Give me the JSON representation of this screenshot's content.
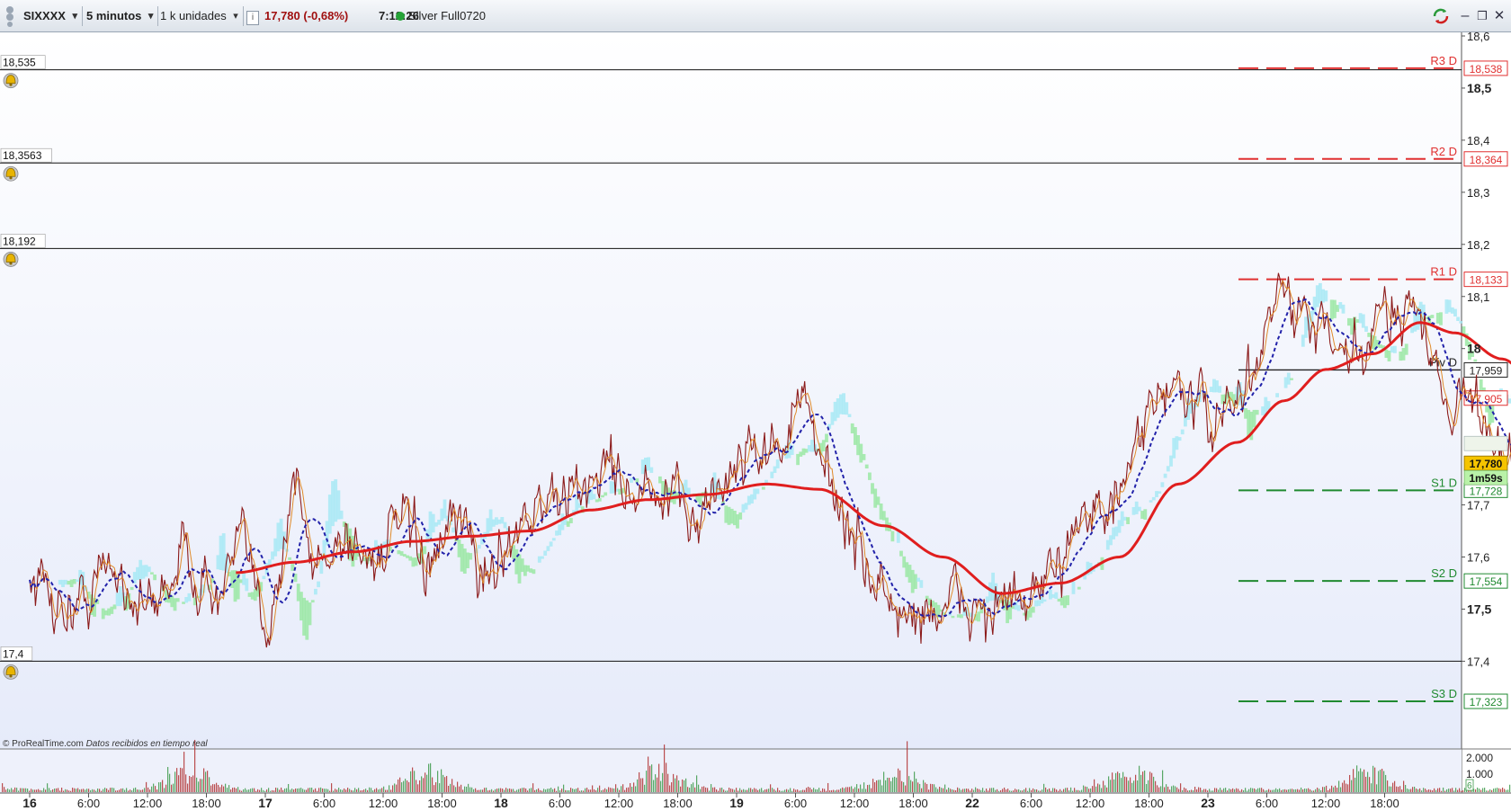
{
  "toolbar": {
    "symbol": "SIXXXX",
    "timeframe": "5 minutos",
    "units": "1 k unidades",
    "info_icon": "i",
    "last_change": "17,780 (-0,68%)",
    "time": "7:12:26",
    "instrument": "Silver Full0720",
    "icons": [
      "settings-icon",
      "refresh-icon",
      "minimize-icon",
      "restore-icon",
      "close-icon"
    ],
    "minimize_glyph": "–",
    "restore_glyph": "❐",
    "close_glyph": "✕"
  },
  "footer": {
    "copyright": "© ProRealTime.com",
    "realtime": "Datos recibidos en tiempo real"
  },
  "colors": {
    "background_top": "#ffffff",
    "background_bottom": "#e6ebfa",
    "price_line": "#8b1a1a",
    "short_ma": "#e08a2a",
    "dashed_ma": "#2222aa",
    "long_ma": "#e01e1e",
    "cloud_bull": "#9be8a5",
    "cloud_bear": "#a8e9f5",
    "resistance": "#e03030",
    "support": "#208a30",
    "pivot": "#222222",
    "last_price_bg": "#f5c400"
  },
  "chart_data": {
    "type": "line",
    "title": "SIXXXX · Silver Full0720 · 5 minutos",
    "ylim": [
      17.355,
      18.63
    ],
    "y_ticks": [
      "18,6",
      "18,5",
      "18,4",
      "18,3",
      "18,2",
      "18,1",
      "18",
      "17,7",
      "17,6",
      "17,5",
      "17,4"
    ],
    "y_ticks_bold": [
      "18,5",
      "18",
      "17,5"
    ],
    "x_ticks": [
      {
        "label": "16",
        "bold": true
      },
      {
        "label": "6:00",
        "bold": false
      },
      {
        "label": "12:00",
        "bold": false
      },
      {
        "label": "18:00",
        "bold": false
      },
      {
        "label": "17",
        "bold": true
      },
      {
        "label": "6:00",
        "bold": false
      },
      {
        "label": "12:00",
        "bold": false
      },
      {
        "label": "18:00",
        "bold": false
      },
      {
        "label": "18",
        "bold": true
      },
      {
        "label": "6:00",
        "bold": false
      },
      {
        "label": "12:00",
        "bold": false
      },
      {
        "label": "18:00",
        "bold": false
      },
      {
        "label": "19",
        "bold": true
      },
      {
        "label": "6:00",
        "bold": false
      },
      {
        "label": "12:00",
        "bold": false
      },
      {
        "label": "18:00",
        "bold": false
      },
      {
        "label": "22",
        "bold": true
      },
      {
        "label": "6:00",
        "bold": false
      },
      {
        "label": "12:00",
        "bold": false
      },
      {
        "label": "18:00",
        "bold": false
      },
      {
        "label": "23",
        "bold": true
      },
      {
        "label": "6:00",
        "bold": false
      },
      {
        "label": "12:00",
        "bold": false
      },
      {
        "label": "18:00",
        "bold": false
      }
    ],
    "alert_lines": [
      {
        "value": 18.535,
        "label": "18,535"
      },
      {
        "value": 18.3563,
        "label": "18,3563"
      },
      {
        "value": 18.192,
        "label": "18,192"
      },
      {
        "value": 17.4,
        "label": "17,4"
      }
    ],
    "pivot_levels": [
      {
        "name": "R3 D",
        "value": 18.538,
        "label": "18,538",
        "kind": "resistance"
      },
      {
        "name": "R2 D",
        "value": 18.364,
        "label": "18,364",
        "kind": "resistance"
      },
      {
        "name": "R1 D",
        "value": 18.133,
        "label": "18,133",
        "kind": "resistance"
      },
      {
        "name": "Piv D",
        "value": 17.959,
        "label": "17,959",
        "kind": "pivot"
      },
      {
        "name": "S1 D",
        "value": 17.728,
        "label": "17,728",
        "kind": "support"
      },
      {
        "name": "S2 D",
        "value": 17.554,
        "label": "17,554",
        "kind": "support"
      },
      {
        "name": "S3 D",
        "value": 17.323,
        "label": "17,323",
        "kind": "support"
      }
    ],
    "last_price": {
      "value": 17.78,
      "label": "17,780",
      "countdown": "1m59s"
    },
    "extra_price_label": {
      "value": 17.905,
      "label": "17,905"
    },
    "volume_ticks": [
      "2.000",
      "1.000"
    ],
    "volume_badge": "6",
    "x_range": [
      0,
      24
    ],
    "price_anchors": [
      [
        0.0,
        17.56
      ],
      [
        0.7,
        17.5
      ],
      [
        1.4,
        17.58
      ],
      [
        2.0,
        17.5
      ],
      [
        2.6,
        17.6
      ],
      [
        3.2,
        17.52
      ],
      [
        3.6,
        17.62
      ],
      [
        4.0,
        17.48
      ],
      [
        4.2,
        17.56
      ],
      [
        4.5,
        17.75
      ],
      [
        4.8,
        17.58
      ],
      [
        5.3,
        17.64
      ],
      [
        5.8,
        17.6
      ],
      [
        6.3,
        17.66
      ],
      [
        6.8,
        17.58
      ],
      [
        7.3,
        17.66
      ],
      [
        7.8,
        17.56
      ],
      [
        8.2,
        17.66
      ],
      [
        8.7,
        17.7
      ],
      [
        9.3,
        17.72
      ],
      [
        9.8,
        17.78
      ],
      [
        10.3,
        17.72
      ],
      [
        10.8,
        17.7
      ],
      [
        11.3,
        17.68
      ],
      [
        11.8,
        17.74
      ],
      [
        12.2,
        17.82
      ],
      [
        12.7,
        17.8
      ],
      [
        13.0,
        17.9
      ],
      [
        13.5,
        17.78
      ],
      [
        14.0,
        17.62
      ],
      [
        14.4,
        17.55
      ],
      [
        14.8,
        17.48
      ],
      [
        15.3,
        17.5
      ],
      [
        15.8,
        17.51
      ],
      [
        16.3,
        17.5
      ],
      [
        16.8,
        17.51
      ],
      [
        17.3,
        17.53
      ],
      [
        17.8,
        17.7
      ],
      [
        18.3,
        17.68
      ],
      [
        18.7,
        17.76
      ],
      [
        19.0,
        17.86
      ],
      [
        19.4,
        17.95
      ],
      [
        19.8,
        17.88
      ],
      [
        20.3,
        17.86
      ],
      [
        20.8,
        17.96
      ],
      [
        21.2,
        18.12
      ],
      [
        21.5,
        18.06
      ],
      [
        21.9,
        18.04
      ],
      [
        22.3,
        17.96
      ],
      [
        22.7,
        18.0
      ],
      [
        23.1,
        18.08
      ],
      [
        23.5,
        18.1
      ],
      [
        23.8,
        17.98
      ],
      [
        24.2,
        17.9
      ],
      [
        24.6,
        17.88
      ],
      [
        25.0,
        17.82
      ],
      [
        25.3,
        17.76
      ],
      [
        25.6,
        17.86
      ],
      [
        26.0,
        17.8
      ],
      [
        26.4,
        17.76
      ],
      [
        26.8,
        17.77
      ]
    ],
    "long_ma_anchors": [
      [
        3.5,
        17.57
      ],
      [
        4.5,
        17.59
      ],
      [
        5.5,
        17.61
      ],
      [
        6.5,
        17.63
      ],
      [
        7.5,
        17.64
      ],
      [
        8.5,
        17.65
      ],
      [
        9.5,
        17.69
      ],
      [
        10.5,
        17.71
      ],
      [
        11.5,
        17.72
      ],
      [
        12.5,
        17.74
      ],
      [
        13.4,
        17.73
      ],
      [
        14.5,
        17.66
      ],
      [
        15.5,
        17.6
      ],
      [
        16.5,
        17.53
      ],
      [
        17.5,
        17.55
      ],
      [
        18.5,
        17.6
      ],
      [
        19.5,
        17.74
      ],
      [
        20.5,
        17.82
      ],
      [
        21.3,
        17.9
      ],
      [
        22.0,
        17.96
      ],
      [
        22.8,
        17.99
      ],
      [
        23.6,
        18.05
      ],
      [
        24.2,
        18.03
      ],
      [
        25.0,
        17.98
      ],
      [
        25.6,
        17.93
      ]
    ]
  }
}
